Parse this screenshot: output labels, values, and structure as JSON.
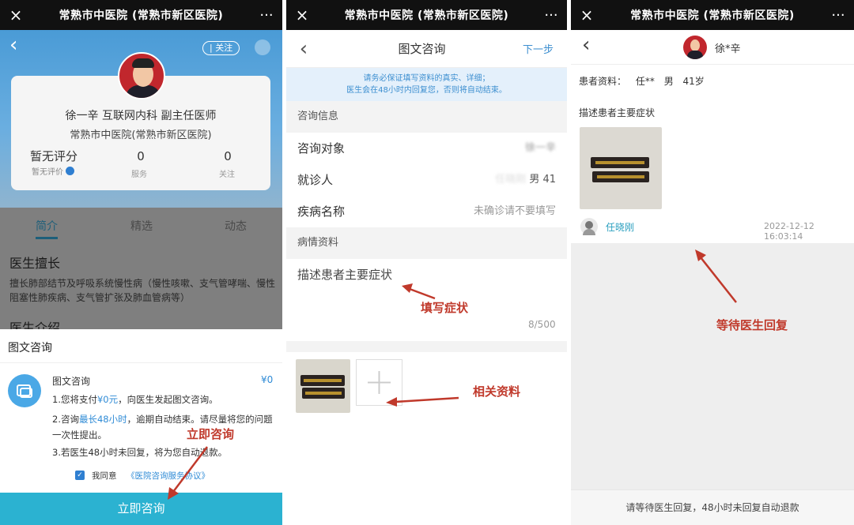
{
  "top_title": "常熟市中医院 (常熟市新区医院)",
  "icons": {
    "close": "×",
    "more": "···",
    "back": "‹"
  },
  "colors": {
    "accent": "#2bb2d1",
    "annotation": "#c0392b",
    "link": "#3d8fd0"
  },
  "p1": {
    "follow": "关注",
    "doctor_line": "徐一辛   互联网内科   副主任医师",
    "hospital": "常熟市中医院(常熟市新区医院)",
    "rating_title": "暂无评分",
    "rating_sub": "暂无评价",
    "services_val": "0",
    "services_label": "服务",
    "follows_val": "0",
    "follows_label": "关注",
    "tabs": [
      "简介",
      "精选",
      "动态"
    ],
    "specialty_title": "医生擅长",
    "specialty_text": "擅长肺部结节及呼吸系统慢性病（慢性咳嗽、支气管哮喘、慢性阻塞性肺疾病、支气管扩张及肺血管病等）",
    "intro_title_partial": "医生介绍",
    "sheet_title": "图文咨询",
    "item_title": "图文咨询",
    "price": "¥0",
    "rule1_a": "1.您将支付",
    "rule1_b": "¥0元",
    "rule1_c": "，向医生发起图文咨询。",
    "rule2_a": "2.咨询",
    "rule2_b": "最长48小时",
    "rule2_c": "，逾期自动结束。请尽量将您的问题一次性提出。",
    "rule3": "3.若医生48小时未回复，将为您自动退款。",
    "agree": "我同意",
    "agreement": "《医院咨询服务协议》",
    "annotation": "立即咨询",
    "cta": "立即咨询"
  },
  "p2": {
    "title": "图文咨询",
    "next": "下一步",
    "notice_line1": "请务必保证填写资料的真实、详细；",
    "notice_line2": "医生会在48小时内回复您，否则将自动结束。",
    "section_info": "咨询信息",
    "target_label": "咨询对象",
    "target_value": "徐一辛",
    "patient_label": "就诊人",
    "patient_value_blur": "任晓刚",
    "patient_value": "男 41",
    "disease_label": "疾病名称",
    "disease_placeholder": "未确诊请不要填写",
    "section_condition": "病情资料",
    "symptom_placeholder": "描述患者主要症状",
    "counter": "8/500",
    "annotation_symptom": "填写症状",
    "annotation_files": "相关资料"
  },
  "p3": {
    "doctor": "徐*辛",
    "patient_info_label": "患者资料：",
    "patient_name": "任**",
    "patient_gender": "男",
    "patient_age": "41岁",
    "symptom_label": "描述患者主要症状",
    "sender": "任晓刚",
    "timestamp": "2022-12-12 16:03:14",
    "annotation": "等待医生回复",
    "footer": "请等待医生回复，48小时未回复自动退款"
  }
}
